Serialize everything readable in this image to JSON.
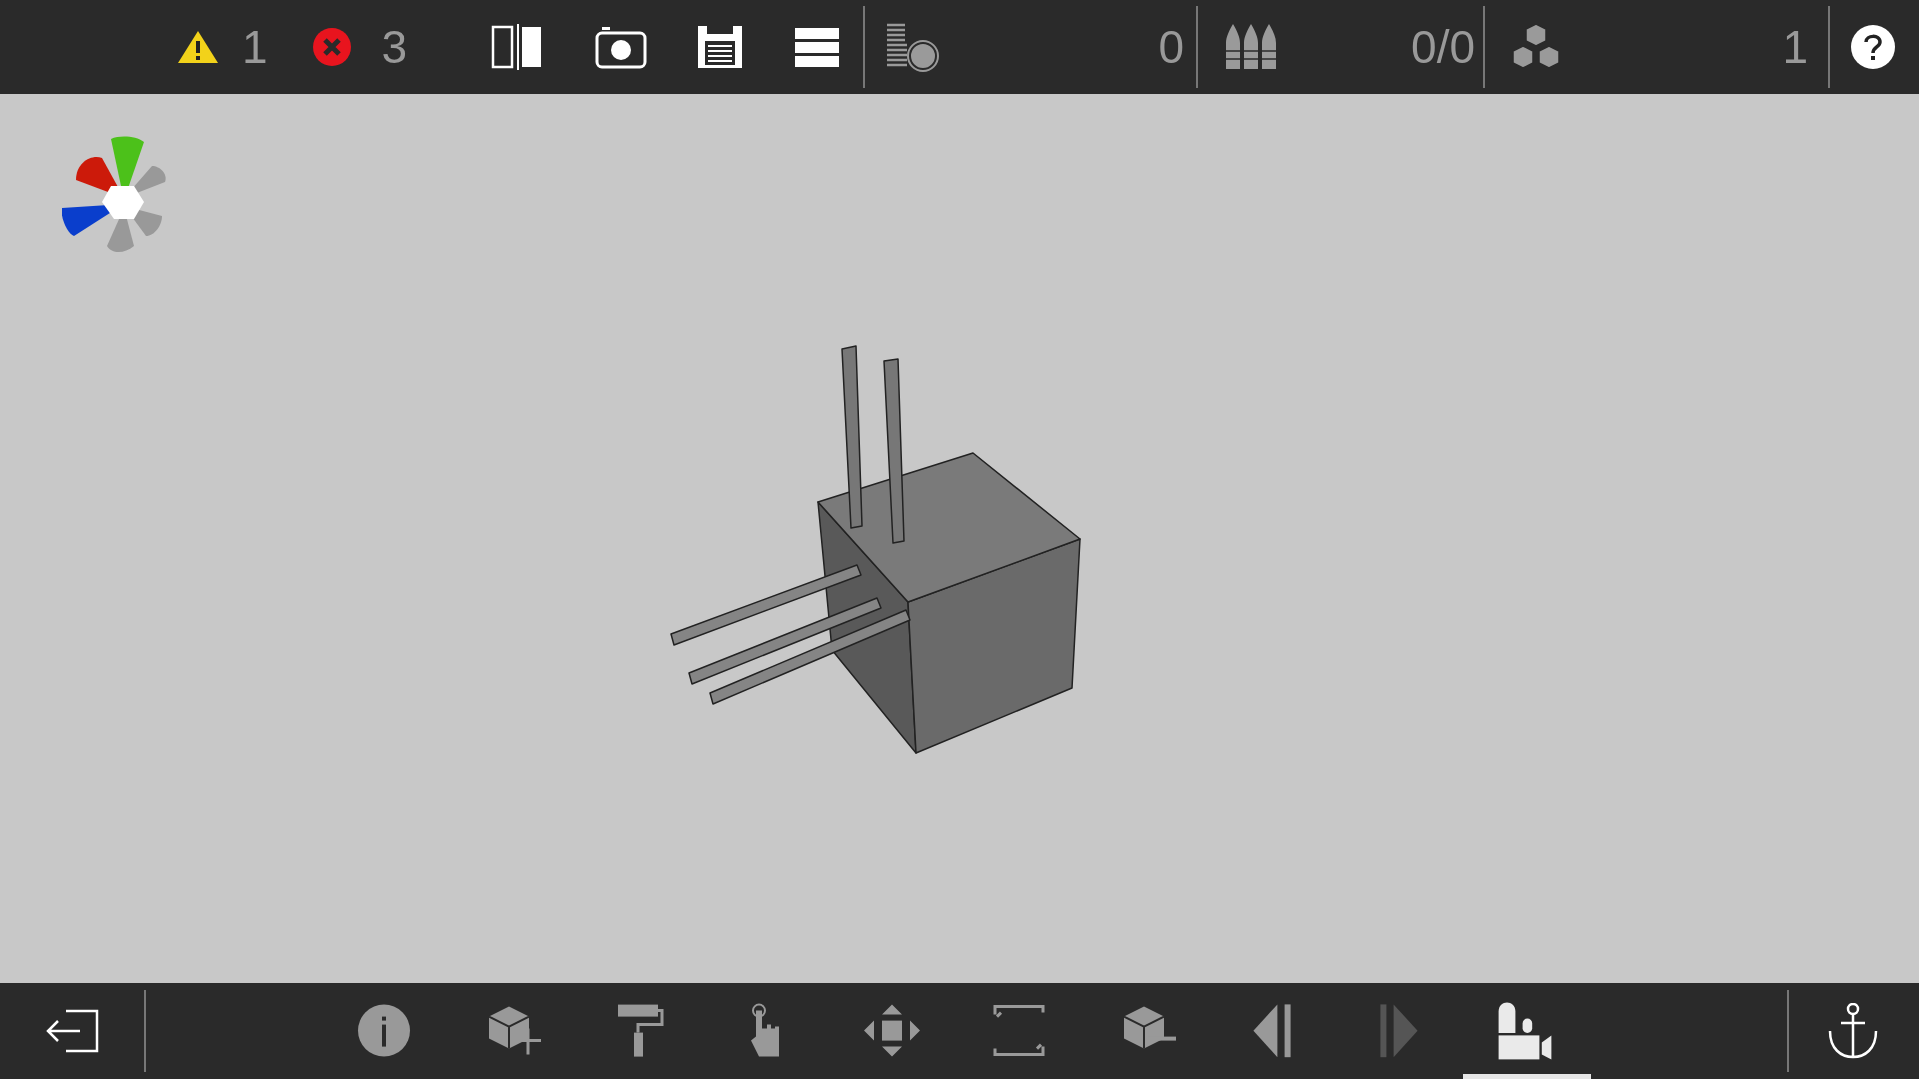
{
  "top_bar": {
    "warnings": "1",
    "errors": "3",
    "layers_count": "0",
    "supports_count": "0/0",
    "parts_count": "1"
  },
  "tools": [
    {
      "kind": "info",
      "selected": false,
      "disabled": false
    },
    {
      "kind": "add",
      "selected": false,
      "disabled": false
    },
    {
      "kind": "paint",
      "selected": false,
      "disabled": false
    },
    {
      "kind": "touch",
      "selected": false,
      "disabled": false
    },
    {
      "kind": "move",
      "selected": false,
      "disabled": false
    },
    {
      "kind": "resize",
      "selected": false,
      "disabled": false
    },
    {
      "kind": "remove",
      "selected": false,
      "disabled": false
    },
    {
      "kind": "prev",
      "selected": false,
      "disabled": false
    },
    {
      "kind": "next",
      "selected": false,
      "disabled": true
    },
    {
      "kind": "camera",
      "selected": true,
      "disabled": false
    }
  ]
}
